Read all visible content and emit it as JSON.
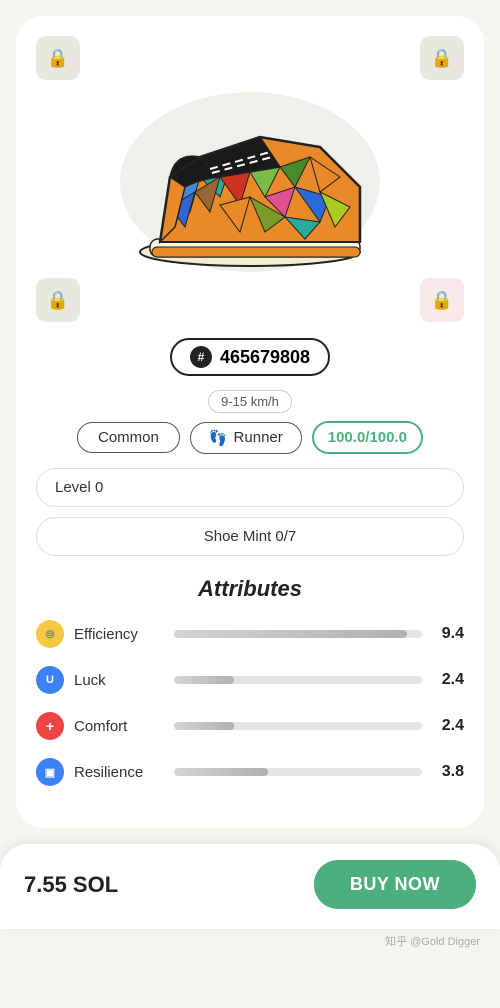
{
  "card": {
    "corner_locks": [
      {
        "position": "top-left",
        "style": "gray"
      },
      {
        "position": "top-right",
        "style": "gray"
      },
      {
        "position": "mid-left",
        "style": "gray"
      },
      {
        "position": "mid-right",
        "style": "red"
      }
    ],
    "token_id": "465679808",
    "hash_symbol": "#",
    "speed_range": "9-15 km/h",
    "type_label": "Common",
    "runner_label": "Runner",
    "runner_icon": "👣",
    "durability": "100.0/100.0",
    "level_label": "Level 0",
    "shoe_mint_label": "Shoe Mint 0/7",
    "attributes_title": "Attributes",
    "attributes": [
      {
        "name": "Efficiency",
        "icon": "efficiency",
        "icon_char": "⊜",
        "value": "9.4",
        "bar_class": "efficiency-fill"
      },
      {
        "name": "Luck",
        "icon": "luck",
        "icon_char": "U",
        "value": "2.4",
        "bar_class": "luck-fill"
      },
      {
        "name": "Comfort",
        "icon": "comfort",
        "icon_char": "+",
        "value": "2.4",
        "bar_class": "comfort-fill"
      },
      {
        "name": "Resilience",
        "icon": "resilience",
        "icon_char": "▣",
        "value": "3.8",
        "bar_class": "resilience-fill"
      }
    ]
  },
  "bottom_bar": {
    "price": "7.55 SOL",
    "buy_button_label": "BUY NOW"
  },
  "watermark": "知乎 @Gold Digger"
}
